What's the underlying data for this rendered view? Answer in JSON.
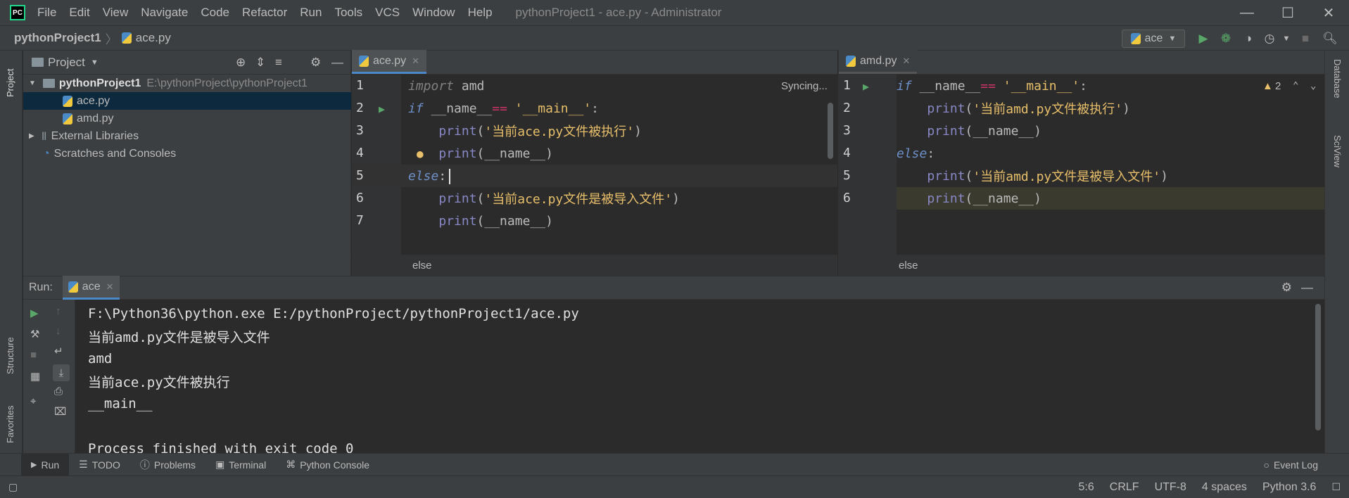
{
  "app": {
    "window_title": "pythonProject1 - ace.py - Administrator",
    "logo_text": "PC",
    "menu": [
      "File",
      "Edit",
      "View",
      "Navigate",
      "Code",
      "Refactor",
      "Run",
      "Tools",
      "VCS",
      "Window",
      "Help"
    ]
  },
  "navbar": {
    "project": "pythonProject1",
    "file": "ace.py",
    "run_config": "ace"
  },
  "left_stripe": {
    "project_label": "Project",
    "structure_label": "Structure",
    "favorites_label": "Favorites"
  },
  "right_stripe": {
    "database_label": "Database",
    "sciview_label": "SciView"
  },
  "project_panel": {
    "title": "Project",
    "tree": [
      {
        "label": "pythonProject1",
        "path": "E:\\pythonProject\\pythonProject1",
        "type": "folder"
      },
      {
        "label": "ace.py",
        "type": "file",
        "selected": true
      },
      {
        "label": "amd.py",
        "type": "file"
      },
      {
        "label": "External Libraries",
        "type": "library"
      },
      {
        "label": "Scratches and Consoles",
        "type": "scratch"
      }
    ]
  },
  "editor_left": {
    "tab": "ace.py",
    "status": "Syncing...",
    "breadcrumb": "else",
    "lines": [
      {
        "n": "1",
        "parts": [
          [
            "dim",
            "import"
          ],
          [
            "plain",
            " amd"
          ]
        ]
      },
      {
        "n": "2",
        "parts": [
          [
            "kwi",
            "if"
          ],
          [
            "plain",
            " __name__"
          ],
          [
            "op",
            "=="
          ],
          [
            "plain",
            " "
          ],
          [
            "strq",
            "'__main__'"
          ],
          [
            "plain",
            ":"
          ]
        ]
      },
      {
        "n": "3",
        "parts": [
          [
            "plain",
            "    "
          ],
          [
            "fn",
            "print"
          ],
          [
            "plain",
            "("
          ],
          [
            "strq",
            "'当前ace.py文件被执行'"
          ],
          [
            "plain",
            ")"
          ]
        ]
      },
      {
        "n": "4",
        "parts": [
          [
            "plain",
            "    "
          ],
          [
            "fn",
            "print"
          ],
          [
            "plain",
            "(__name__)"
          ]
        ]
      },
      {
        "n": "5",
        "parts": [
          [
            "kwi",
            "else"
          ],
          [
            "plain",
            ":"
          ]
        ]
      },
      {
        "n": "6",
        "parts": [
          [
            "plain",
            "    "
          ],
          [
            "fn",
            "print"
          ],
          [
            "plain",
            "("
          ],
          [
            "strq",
            "'当前ace.py文件是被导入文件'"
          ],
          [
            "plain",
            ")"
          ]
        ]
      },
      {
        "n": "7",
        "parts": [
          [
            "plain",
            "    "
          ],
          [
            "fn",
            "print"
          ],
          [
            "plain",
            "(__name__)"
          ]
        ]
      }
    ]
  },
  "editor_right": {
    "tab": "amd.py",
    "warnings": "2",
    "breadcrumb": "else",
    "lines": [
      {
        "n": "1",
        "parts": [
          [
            "kwi",
            "if"
          ],
          [
            "plain",
            " __name__"
          ],
          [
            "op",
            "=="
          ],
          [
            "plain",
            " "
          ],
          [
            "strq",
            "'__main__'"
          ],
          [
            "plain",
            ":"
          ]
        ]
      },
      {
        "n": "2",
        "parts": [
          [
            "plain",
            "    "
          ],
          [
            "fn",
            "print"
          ],
          [
            "plain",
            "("
          ],
          [
            "strq",
            "'当前amd.py文件被执行'"
          ],
          [
            "plain",
            ")"
          ]
        ]
      },
      {
        "n": "3",
        "parts": [
          [
            "plain",
            "    "
          ],
          [
            "fn",
            "print"
          ],
          [
            "plain",
            "(__name__)"
          ]
        ]
      },
      {
        "n": "4",
        "parts": [
          [
            "kwi",
            "else"
          ],
          [
            "plain",
            ":"
          ]
        ]
      },
      {
        "n": "5",
        "parts": [
          [
            "plain",
            "    "
          ],
          [
            "fn",
            "print"
          ],
          [
            "plain",
            "("
          ],
          [
            "strq",
            "'当前amd.py文件是被导入文件'"
          ],
          [
            "plain",
            ")"
          ]
        ]
      },
      {
        "n": "6",
        "parts": [
          [
            "plain",
            "    "
          ],
          [
            "fn",
            "print"
          ],
          [
            "plain",
            "(__name__)"
          ]
        ]
      }
    ]
  },
  "run_panel": {
    "label": "Run:",
    "tab": "ace",
    "output": [
      "F:\\Python36\\python.exe E:/pythonProject/pythonProject1/ace.py",
      "当前amd.py文件是被导入文件",
      "amd",
      "当前ace.py文件被执行",
      "__main__",
      "",
      "Process finished with exit code 0"
    ]
  },
  "tool_tabs": [
    "Run",
    "TODO",
    "Problems",
    "Terminal",
    "Python Console"
  ],
  "event_log": "Event Log",
  "status": {
    "position": "5:6",
    "line_sep": "CRLF",
    "encoding": "UTF-8",
    "indent": "4 spaces",
    "interpreter": "Python 3.6"
  },
  "colors": {
    "accent": "#4a88c7",
    "run_green": "#59a869",
    "keyword": "#6e8fc8",
    "string": "#e8bf6a"
  }
}
